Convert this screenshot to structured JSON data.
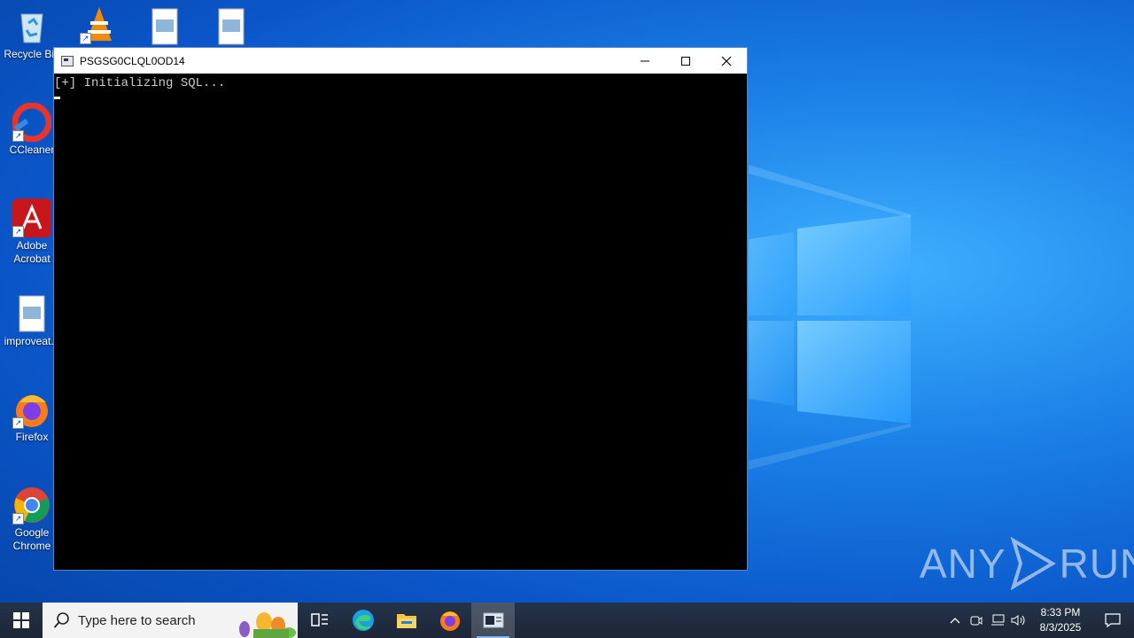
{
  "desktop": {
    "icons": [
      {
        "label": "Recycle Bin",
        "icon": "recycle-bin-icon"
      },
      {
        "label": "CCleaner",
        "icon": "ccleaner-icon"
      },
      {
        "label": "Adobe Acrobat",
        "icon": "adobe-acrobat-icon"
      },
      {
        "label": "improveat...",
        "icon": "image-file-icon"
      },
      {
        "label": "Firefox",
        "icon": "firefox-icon"
      },
      {
        "label": "Google Chrome",
        "icon": "chrome-icon"
      }
    ],
    "top_icons": [
      "vlc-icon",
      "image-file-icon",
      "image-file-icon"
    ]
  },
  "console_window": {
    "title": "PSGSG0CLQL0OD14",
    "lines": [
      "[+] Initializing SQL..."
    ],
    "buttons": {
      "minimize": "minimize-icon",
      "maximize": "maximize-icon",
      "close": "close-icon"
    }
  },
  "watermark": {
    "left": "ANY",
    "right": "RUN"
  },
  "taskbar": {
    "search_placeholder": "Type here to search",
    "apps": [
      "task-view-icon",
      "edge-icon",
      "file-explorer-icon",
      "firefox-icon",
      "console-icon"
    ],
    "clock": {
      "time": "8:33 PM",
      "date": "8/3/2025"
    }
  },
  "colors": {
    "accent": "#0a55c8",
    "taskbar": "#1e2a3a",
    "console_bg": "#000000"
  }
}
